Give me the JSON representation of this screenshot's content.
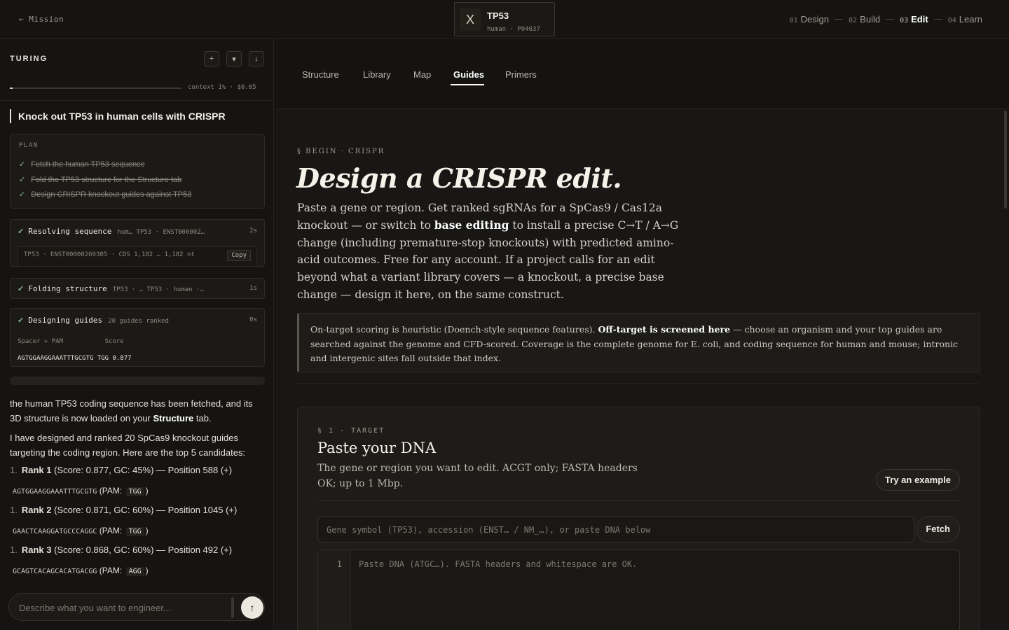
{
  "header": {
    "back_label": "← Mission",
    "target": {
      "icon": "X",
      "name": "TP53",
      "sub": "human · P04637"
    },
    "steps": [
      {
        "num": "01",
        "label": "Design"
      },
      {
        "num": "02",
        "label": "Build"
      },
      {
        "num": "03",
        "label": "Edit"
      },
      {
        "num": "04",
        "label": "Learn"
      }
    ],
    "active_step": "03"
  },
  "sidebar": {
    "title": "TURING",
    "buttons": [
      "+",
      "▾",
      "↓"
    ],
    "context": {
      "label": "context 1% · $0.05",
      "percent": 1
    },
    "task_title": "Knock out TP53 in human cells with CRISPR",
    "plan": {
      "label": "PLAN",
      "items": [
        "Fetch the human TP53 sequence",
        "Fold the TP53 structure for the Structure tab",
        "Design CRISPR knockout guides against TP53"
      ]
    },
    "tool_steps": [
      {
        "label": "Resolving sequence",
        "meta": "hum… TP53 · ENST000002…",
        "time": "2s",
        "detail": "TP53 · ENST00000269305 · CDS 1,182 … 1,182 nt",
        "copy_label": "Copy"
      },
      {
        "label": "Folding structure",
        "meta": "TP53 · … TP53 · human ·…",
        "time": "1s"
      },
      {
        "label": "Designing guides",
        "meta": "20 guides ranked",
        "time": "0s",
        "table_head": "Spacer + PAM           Score",
        "table_row": "AGTGGAAGGAAATTTGCGTG TGG 0.877"
      }
    ],
    "chat": {
      "p1_a": "the human TP53 coding sequence has been fetched, and its 3D structure is now loaded on your ",
      "p1_b": "Structure",
      "p1_c": " tab.",
      "p2": "I have designed and ranked 20 SpCas9 knockout guides targeting the coding region. Here are the top 5 candidates:",
      "candidates": [
        {
          "n": "1.",
          "rank": "Rank 1",
          "detail": "(Score: 0.877, GC: 45%) — Position 588 (+)",
          "seq": "AGTGGAAGGAAATTTGCGTG",
          "pam_pre": "(PAM:",
          "pam": "TGG",
          "pam_post": ")"
        },
        {
          "n": "1.",
          "rank": "Rank 2",
          "detail": "(Score: 0.871, GC: 60%) — Position 1045 (+)",
          "seq": "GAACTCAAGGATGCCCAGGC",
          "pam_pre": "(PAM:",
          "pam": "TGG",
          "pam_post": ")"
        },
        {
          "n": "1.",
          "rank": "Rank 3",
          "detail": "(Score: 0.868, GC: 60%) — Position 492 (+)",
          "seq": "GCAGTCACAGCACATGACGG",
          "pam_pre": "(PAM:",
          "pam": "AGG",
          "pam_post": ")"
        }
      ]
    },
    "composer": {
      "placeholder": "Describe what you want to engineer...",
      "send": "↑"
    }
  },
  "main": {
    "tabs": [
      "Structure",
      "Library",
      "Map",
      "Guides",
      "Primers"
    ],
    "active_tab": "Guides",
    "kicker": "§ BEGIN · CRISPR",
    "heading": "Design a CRISPR edit.",
    "lede_a": "Paste a gene or region. Get ranked sgRNAs for a SpCas9 / Cas12a knockout — or switch to ",
    "lede_b": "base editing",
    "lede_c": " to install a precise C→T / A→G change (including premature-stop knockouts) with predicted amino-acid outcomes. Free for any account. If a project calls for an edit beyond what a variant library covers — a knockout, a precise base change — design it here, on the same construct.",
    "note_a": "On-target scoring is heuristic (Doench-style sequence features). ",
    "note_b": "Off-target is screened here",
    "note_c": " — choose an organism and your top guides are searched against the genome and CFD-scored. Coverage is the complete genome for E. coli, and coding sequence for human and mouse; intronic and intergenic sites fall outside that index.",
    "panel": {
      "kicker": "§ 1 · TARGET",
      "title": "Paste your DNA",
      "desc": "The gene or region you want to edit. ACGT only; FASTA headers OK; up to 1 Mbp.",
      "example_label": "Try an example",
      "search_placeholder": "Gene symbol (TP53), accession (ENST… / NM_…), or paste DNA below",
      "fetch_label": "Fetch",
      "line_no": "1",
      "editor_placeholder": "Paste DNA (ATGC…). FASTA headers and whitespace are OK."
    }
  }
}
